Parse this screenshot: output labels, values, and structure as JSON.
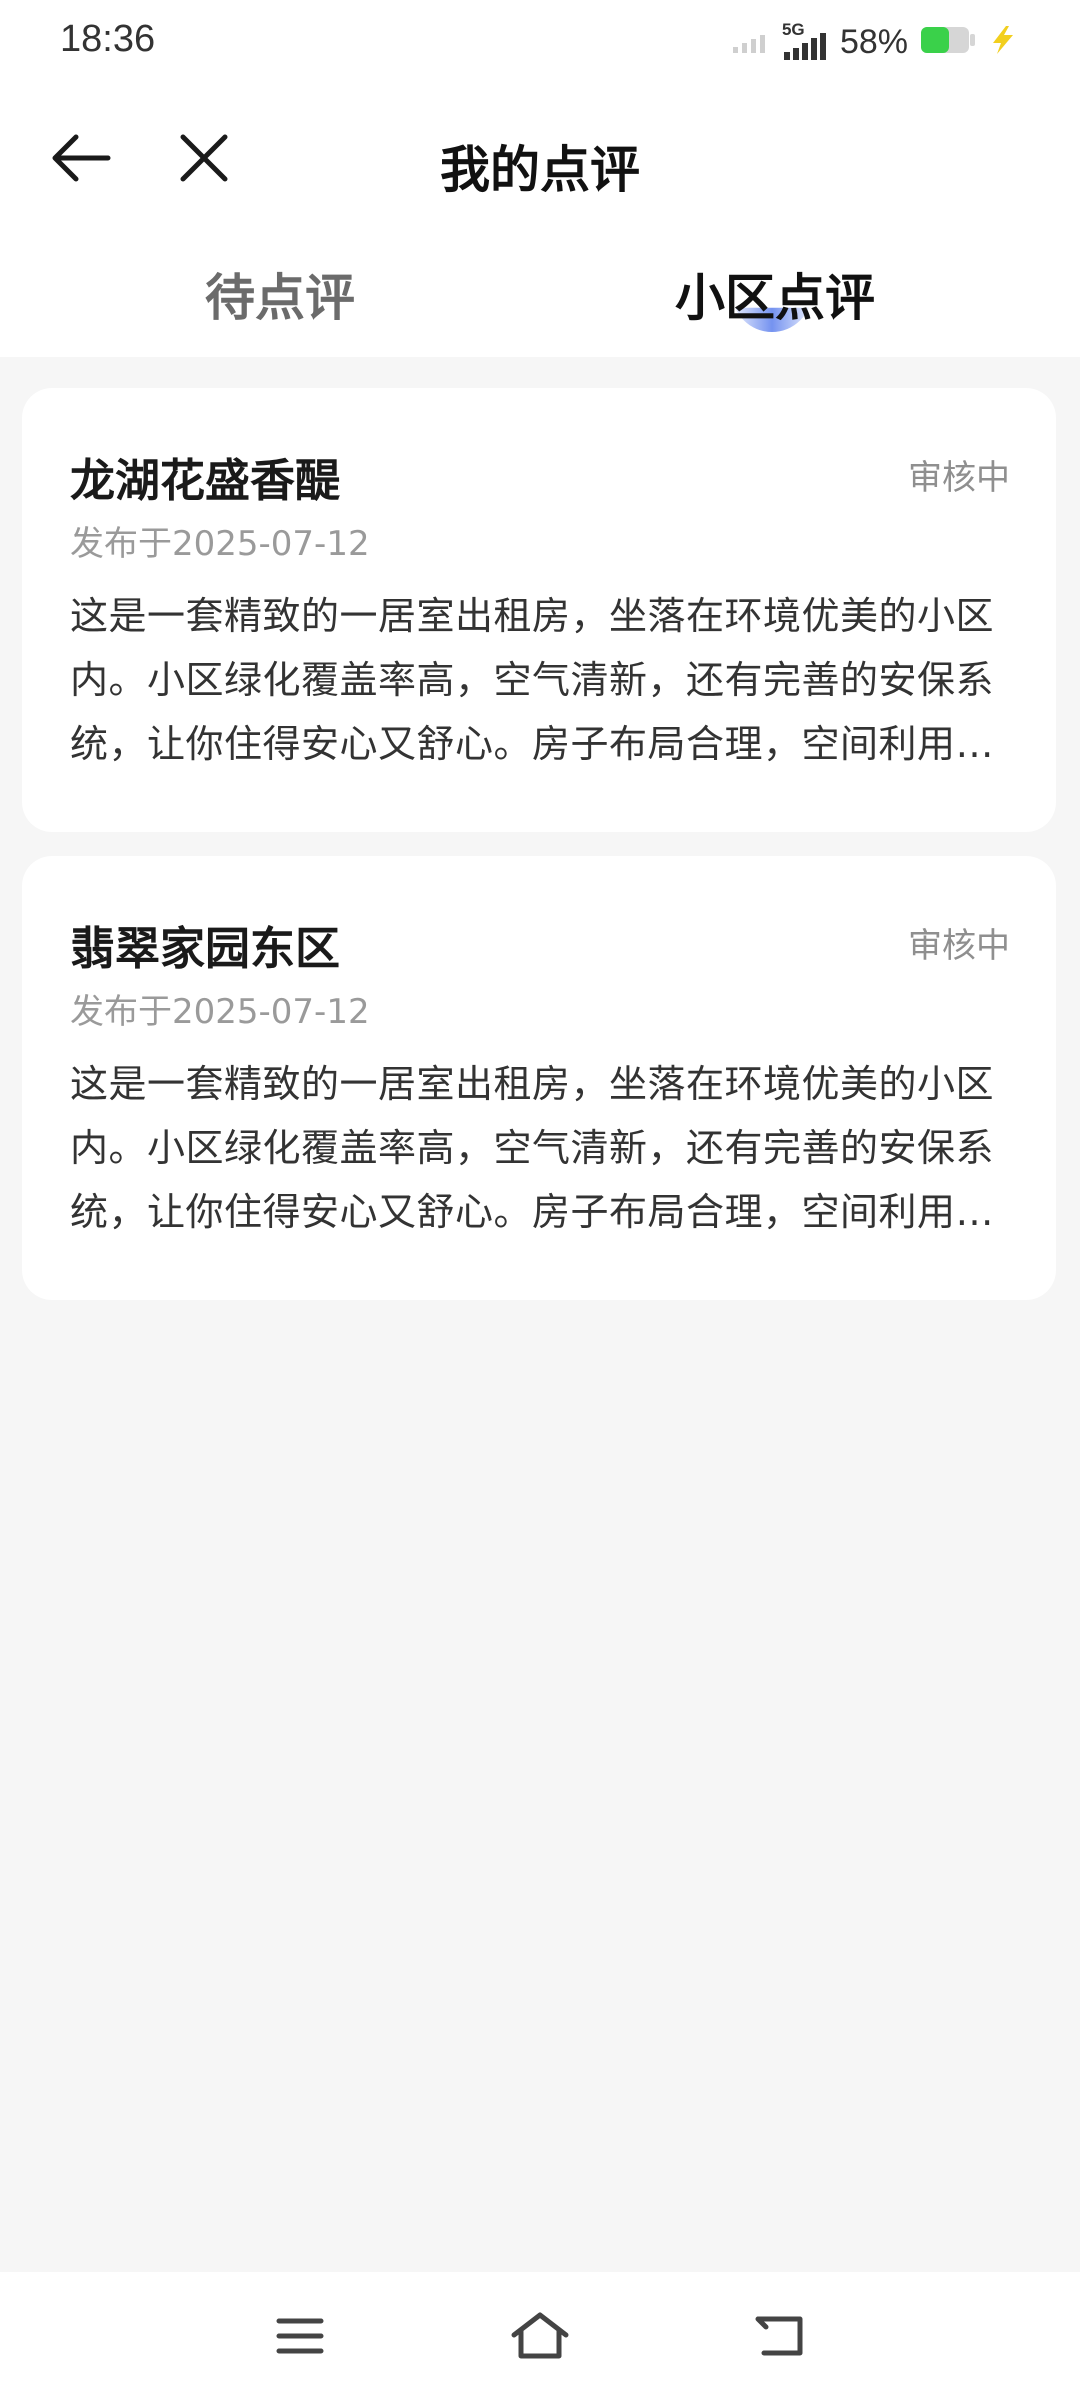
{
  "status_bar": {
    "time": "18:36",
    "network": "5G",
    "battery_percent": "58%",
    "battery_level": 0.58,
    "icons": [
      "signal-weak-icon",
      "signal-5g-icon",
      "battery-icon",
      "charging-icon"
    ]
  },
  "header": {
    "title": "我的点评",
    "back_icon": "arrow-left-icon",
    "close_icon": "close-icon"
  },
  "tabs": [
    {
      "label": "待点评",
      "active": false
    },
    {
      "label": "小区点评",
      "active": true
    }
  ],
  "colors": {
    "background": "#f6f6f6",
    "card": "#ffffff",
    "active_indicator": "#466eeb",
    "muted_text": "#9a9a9a"
  },
  "reviews": [
    {
      "title": "龙湖花盛香醍",
      "status": "审核中",
      "date": "发布于2025-07-12",
      "body": "这是一套精致的一居室出租房，坐落在环境优美的小区内。小区绿化覆盖率高，空气清新，还有完善的安保系统，让你住得安心又舒心。房子布局合理，空间利用率高"
    },
    {
      "title": "翡翠家园东区",
      "status": "审核中",
      "date": "发布于2025-07-12",
      "body": "这是一套精致的一居室出租房，坐落在环境优美的小区内。小区绿化覆盖率高，空气清新，还有完善的安保系统，让你住得安心又舒心。房子布局合理，空间利用率高"
    }
  ],
  "nav_bar": {
    "icons": [
      "menu-icon",
      "home-icon",
      "back-icon"
    ]
  }
}
